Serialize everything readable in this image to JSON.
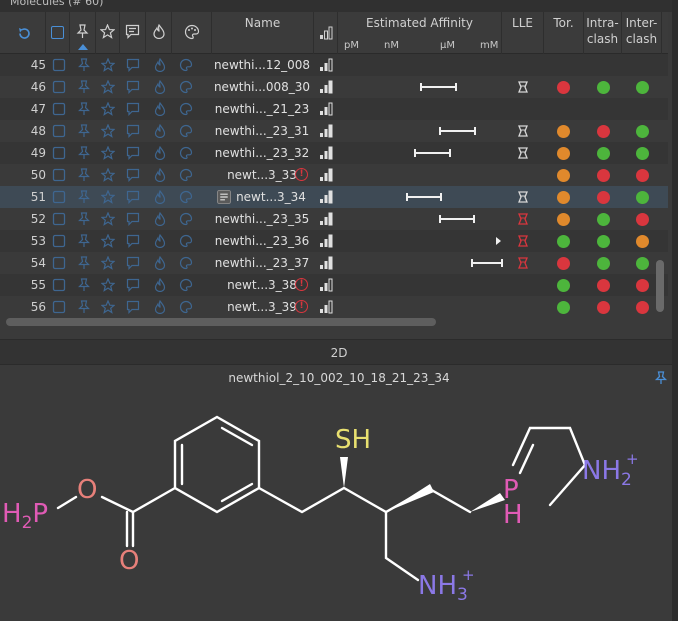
{
  "panel_title": "Molecules (# 60)",
  "columns": {
    "name": "Name",
    "affinity": "Estimated Affinity",
    "affinity_units": [
      "pM",
      "nM",
      "µM",
      "mM"
    ],
    "lle": "LLE",
    "tor": "Tor.",
    "intra": "Intra-\nclash",
    "inter": "Inter-\nclash",
    "intra_1": "Intra-",
    "intra_2": "clash",
    "inter_1": "Inter-",
    "inter_2": "clash"
  },
  "colors": {
    "red": "#d9363e",
    "green": "#4db53c",
    "orange": "#e0892c",
    "blue_icon": "#4a7fb5"
  },
  "rows": [
    {
      "num": "45",
      "name": "newthi...12_008",
      "tor": "",
      "intra": "",
      "inter": ""
    },
    {
      "num": "46",
      "name": "newthi...008_30",
      "tor": "red",
      "intra": "green",
      "inter": "green"
    },
    {
      "num": "47",
      "name": "newthi..._21_23",
      "tor": "",
      "intra": "",
      "inter": ""
    },
    {
      "num": "48",
      "name": "newthi..._23_31",
      "tor": "orange",
      "intra": "red",
      "inter": "green"
    },
    {
      "num": "49",
      "name": "newthi..._23_32",
      "tor": "orange",
      "intra": "green",
      "inter": "green"
    },
    {
      "num": "50",
      "name": "newt...3_33",
      "tor": "orange",
      "intra": "red",
      "inter": "red"
    },
    {
      "num": "51",
      "name": "newt...3_34",
      "tor": "orange",
      "intra": "red",
      "inter": "green"
    },
    {
      "num": "52",
      "name": "newthi..._23_35",
      "tor": "orange",
      "intra": "green",
      "inter": "red"
    },
    {
      "num": "53",
      "name": "newthi..._23_36",
      "tor": "green",
      "intra": "green",
      "inter": "orange"
    },
    {
      "num": "54",
      "name": "newthi..._23_37",
      "tor": "red",
      "intra": "green",
      "inter": "green"
    },
    {
      "num": "55",
      "name": "newt...3_38",
      "tor": "green",
      "intra": "red",
      "inter": "red"
    },
    {
      "num": "56",
      "name": "newt...3_39",
      "tor": "green",
      "intra": "red",
      "inter": "red"
    }
  ],
  "error_mark": "!",
  "section_2d": "2D",
  "molecule_name": "newthiol_2_10_002_10_18_21_23_34",
  "atoms": {
    "h2p": "H",
    "h2p_sub": "2",
    "h2p_p": "P",
    "o_ester": "O",
    "o_carbonyl": "O",
    "sh": "SH",
    "p_ring": "P",
    "h_ring": "H",
    "nh2": "NH",
    "nh2_sub": "2",
    "nh2_sup": "+",
    "nh3": "NH",
    "nh3_sub": "3",
    "nh3_sup": "+"
  }
}
